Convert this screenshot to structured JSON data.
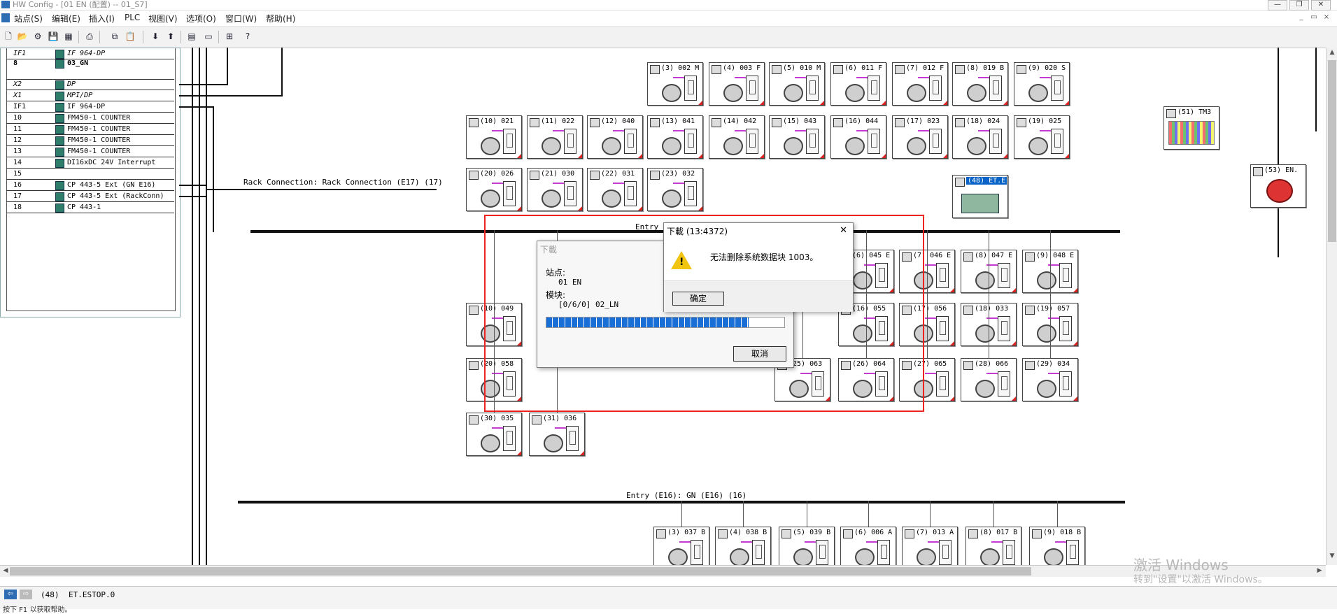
{
  "window": {
    "title": "HW Config - [01 EN (配置) -- 01_S7]",
    "controls": [
      "—",
      "❐",
      "✕"
    ],
    "mdi_controls": [
      "_",
      "▭",
      "×"
    ]
  },
  "menu": [
    "站点(S)",
    "编辑(E)",
    "插入(I)",
    "PLC",
    "视图(V)",
    "选项(O)",
    "窗口(W)",
    "帮助(H)"
  ],
  "toolbar_icons": [
    "new-icon",
    "open-icon",
    "network-icon",
    "save-icon",
    "save-compile-icon",
    "print-icon",
    "copy-icon",
    "paste-icon",
    "download-icon",
    "upload-icon",
    "catalog-icon",
    "window-icon",
    "network-view-icon",
    "help-icon"
  ],
  "rack_rows": [
    {
      "slot": "IF1",
      "module": "IF 964-DP",
      "style": "ital"
    },
    {
      "slot": "8",
      "module": "03_GN",
      "style": "bold"
    },
    {
      "slot": "",
      "module": "",
      "style": "plain"
    },
    {
      "slot": "X2",
      "module": "DP",
      "style": "ital"
    },
    {
      "slot": "X1",
      "module": "MPI/DP",
      "style": "ital"
    },
    {
      "slot": "IF1",
      "module": "IF 964-DP",
      "style": "plain"
    },
    {
      "slot": "10",
      "module": "FM450-1 COUNTER",
      "style": "plain"
    },
    {
      "slot": "11",
      "module": "FM450-1 COUNTER",
      "style": "plain"
    },
    {
      "slot": "12",
      "module": "FM450-1 COUNTER",
      "style": "plain"
    },
    {
      "slot": "13",
      "module": "FM450-1 COUNTER",
      "style": "plain"
    },
    {
      "slot": "14",
      "module": "DI16xDC 24V Interrupt",
      "style": "plain"
    },
    {
      "slot": "15",
      "module": "",
      "style": "plain"
    },
    {
      "slot": "16",
      "module": "CP 443-5 Ext (GN E16)",
      "style": "plain"
    },
    {
      "slot": "17",
      "module": "CP 443-5 Ext (RackConn)",
      "style": "plain"
    },
    {
      "slot": "18",
      "module": "CP 443-1",
      "style": "plain"
    }
  ],
  "labels": {
    "rack_connection": "Rack Connection: Rack Connection (E17) (17)",
    "entry_mid": "Entry (E",
    "entry_e16": "Entry (E16): GN (E16) (16)"
  },
  "devices": [
    {
      "label": "(3) 002 M",
      "type": "drive"
    },
    {
      "label": "(4) 003 F",
      "type": "drive"
    },
    {
      "label": "(5) 010 M",
      "type": "drive"
    },
    {
      "label": "(6) 011 F",
      "type": "drive"
    },
    {
      "label": "(7) 012 F",
      "type": "drive"
    },
    {
      "label": "(8) 019 B",
      "type": "drive"
    },
    {
      "label": "(9) 020 S",
      "type": "drive"
    },
    {
      "label": "(10) 021",
      "type": "drive"
    },
    {
      "label": "(11) 022",
      "type": "drive"
    },
    {
      "label": "(12) 040",
      "type": "drive"
    },
    {
      "label": "(13) 041",
      "type": "drive"
    },
    {
      "label": "(14) 042",
      "type": "drive"
    },
    {
      "label": "(15) 043",
      "type": "drive"
    },
    {
      "label": "(16) 044",
      "type": "drive"
    },
    {
      "label": "(17) 023",
      "type": "drive"
    },
    {
      "label": "(18) 024",
      "type": "drive"
    },
    {
      "label": "(19) 025",
      "type": "drive"
    },
    {
      "label": "(20) 026",
      "type": "drive"
    },
    {
      "label": "(21) 030",
      "type": "drive"
    },
    {
      "label": "(22) 031",
      "type": "drive"
    },
    {
      "label": "(23) 032",
      "type": "drive"
    },
    {
      "label": "(48) ET.E",
      "type": "et"
    },
    {
      "label": "(51) TM3",
      "type": "tm"
    },
    {
      "label": "(53) EN.",
      "type": "encoder"
    },
    {
      "label": "(6) 045 E",
      "type": "drive"
    },
    {
      "label": "(7) 046 E",
      "type": "drive"
    },
    {
      "label": "(8) 047 E",
      "type": "drive"
    },
    {
      "label": "(9) 048 E",
      "type": "drive"
    },
    {
      "label": "(10) 049",
      "type": "drive"
    },
    {
      "label": "(16) 055",
      "type": "drive"
    },
    {
      "label": "(17) 056",
      "type": "drive"
    },
    {
      "label": "(18) 033",
      "type": "drive"
    },
    {
      "label": "(19) 057",
      "type": "drive"
    },
    {
      "label": "(20) 058",
      "type": "drive"
    },
    {
      "label": "(25) 063",
      "type": "drive"
    },
    {
      "label": "(26) 064",
      "type": "drive"
    },
    {
      "label": "(27) 065",
      "type": "drive"
    },
    {
      "label": "(28) 066",
      "type": "drive"
    },
    {
      "label": "(29) 034",
      "type": "drive"
    },
    {
      "label": "(30) 035",
      "type": "drive"
    },
    {
      "label": "(31) 036",
      "type": "drive"
    },
    {
      "label": "(3) 037 B",
      "type": "drive"
    },
    {
      "label": "(4) 038 B",
      "type": "drive"
    },
    {
      "label": "(5) 039 B",
      "type": "drive"
    },
    {
      "label": "(6) 006 A",
      "type": "drive"
    },
    {
      "label": "(7) 013 A",
      "type": "drive"
    },
    {
      "label": "(8) 017 B",
      "type": "drive"
    },
    {
      "label": "(9) 018 B",
      "type": "drive"
    }
  ],
  "download_dialog": {
    "title": "下載",
    "station_label": "站点:",
    "station_value": "01 EN",
    "module_label": "模块:",
    "module_value": "[0/6/0] 02_LN",
    "progress": 0.85,
    "cancel_label": "取消"
  },
  "error_dialog": {
    "title": "下載 (13:4372)",
    "message": "无法删除系统数据块 1003。",
    "ok_label": "确定",
    "close_glyph": "✕"
  },
  "status": {
    "count": "(48)",
    "selection": "ET.ESTOP.0",
    "hint": "按下 F1 以获取帮助。"
  },
  "watermark": {
    "line1": "激活 Windows",
    "line2": "转到\"设置\"以激活 Windows。"
  },
  "colors": {
    "selection": "#0a64c8",
    "alert_frame": "#e22222",
    "progress": "#1a6fd6",
    "cable": "#c33bd1"
  }
}
